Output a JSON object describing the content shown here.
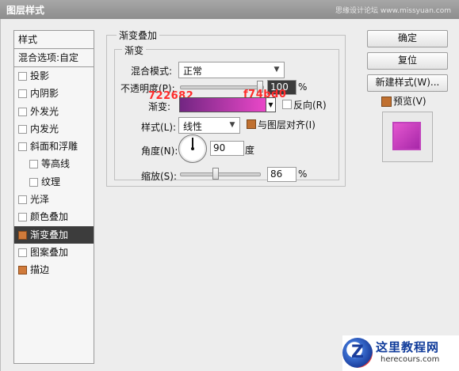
{
  "window": {
    "title": "图层样式",
    "watermark": "思缘设计论坛 www.missyuan.com"
  },
  "left_panel": {
    "header": "样式",
    "blend_options": "混合选项:自定",
    "items": [
      {
        "label": "投影",
        "checked": false,
        "sub": false,
        "selected": false
      },
      {
        "label": "内阴影",
        "checked": false,
        "sub": false,
        "selected": false
      },
      {
        "label": "外发光",
        "checked": false,
        "sub": false,
        "selected": false
      },
      {
        "label": "内发光",
        "checked": false,
        "sub": false,
        "selected": false
      },
      {
        "label": "斜面和浮雕",
        "checked": false,
        "sub": false,
        "selected": false
      },
      {
        "label": "等高线",
        "checked": false,
        "sub": true,
        "selected": false
      },
      {
        "label": "纹理",
        "checked": false,
        "sub": true,
        "selected": false
      },
      {
        "label": "光泽",
        "checked": false,
        "sub": false,
        "selected": false
      },
      {
        "label": "颜色叠加",
        "checked": false,
        "sub": false,
        "selected": false
      },
      {
        "label": "渐变叠加",
        "checked": true,
        "sub": false,
        "selected": true
      },
      {
        "label": "图案叠加",
        "checked": false,
        "sub": false,
        "selected": false
      },
      {
        "label": "描边",
        "checked": true,
        "sub": false,
        "selected": false
      }
    ]
  },
  "buttons": {
    "ok": "确定",
    "reset": "复位",
    "new_style": "新建样式(W)...",
    "preview": "预览(V)",
    "preview_checked": true
  },
  "gradient_overlay": {
    "group_title": "渐变叠加",
    "sub_title": "渐变",
    "blend_mode_label": "混合模式:",
    "blend_mode_value": "正常",
    "opacity_label": "不透明度(P):",
    "opacity_value": "100",
    "opacity_unit": "%",
    "opacity_fraction": 1.0,
    "gradient_label": "渐变:",
    "gradient_colors": [
      "#722682",
      "#f74bd0"
    ],
    "color_annotation_left": "722682",
    "color_annotation_right": "f74bd0",
    "reverse_label": "反向(R)",
    "reverse_checked": false,
    "style_label": "样式(L):",
    "style_value": "线性",
    "align_label": "与图层对齐(I)",
    "align_checked": true,
    "angle_label": "角度(N):",
    "angle_value": "90",
    "angle_unit": "度",
    "scale_label": "缩放(S):",
    "scale_value": "86",
    "scale_unit": "%",
    "scale_fraction": 0.86
  },
  "logo": {
    "cn": "这里教程网",
    "en": "herecours.com"
  }
}
